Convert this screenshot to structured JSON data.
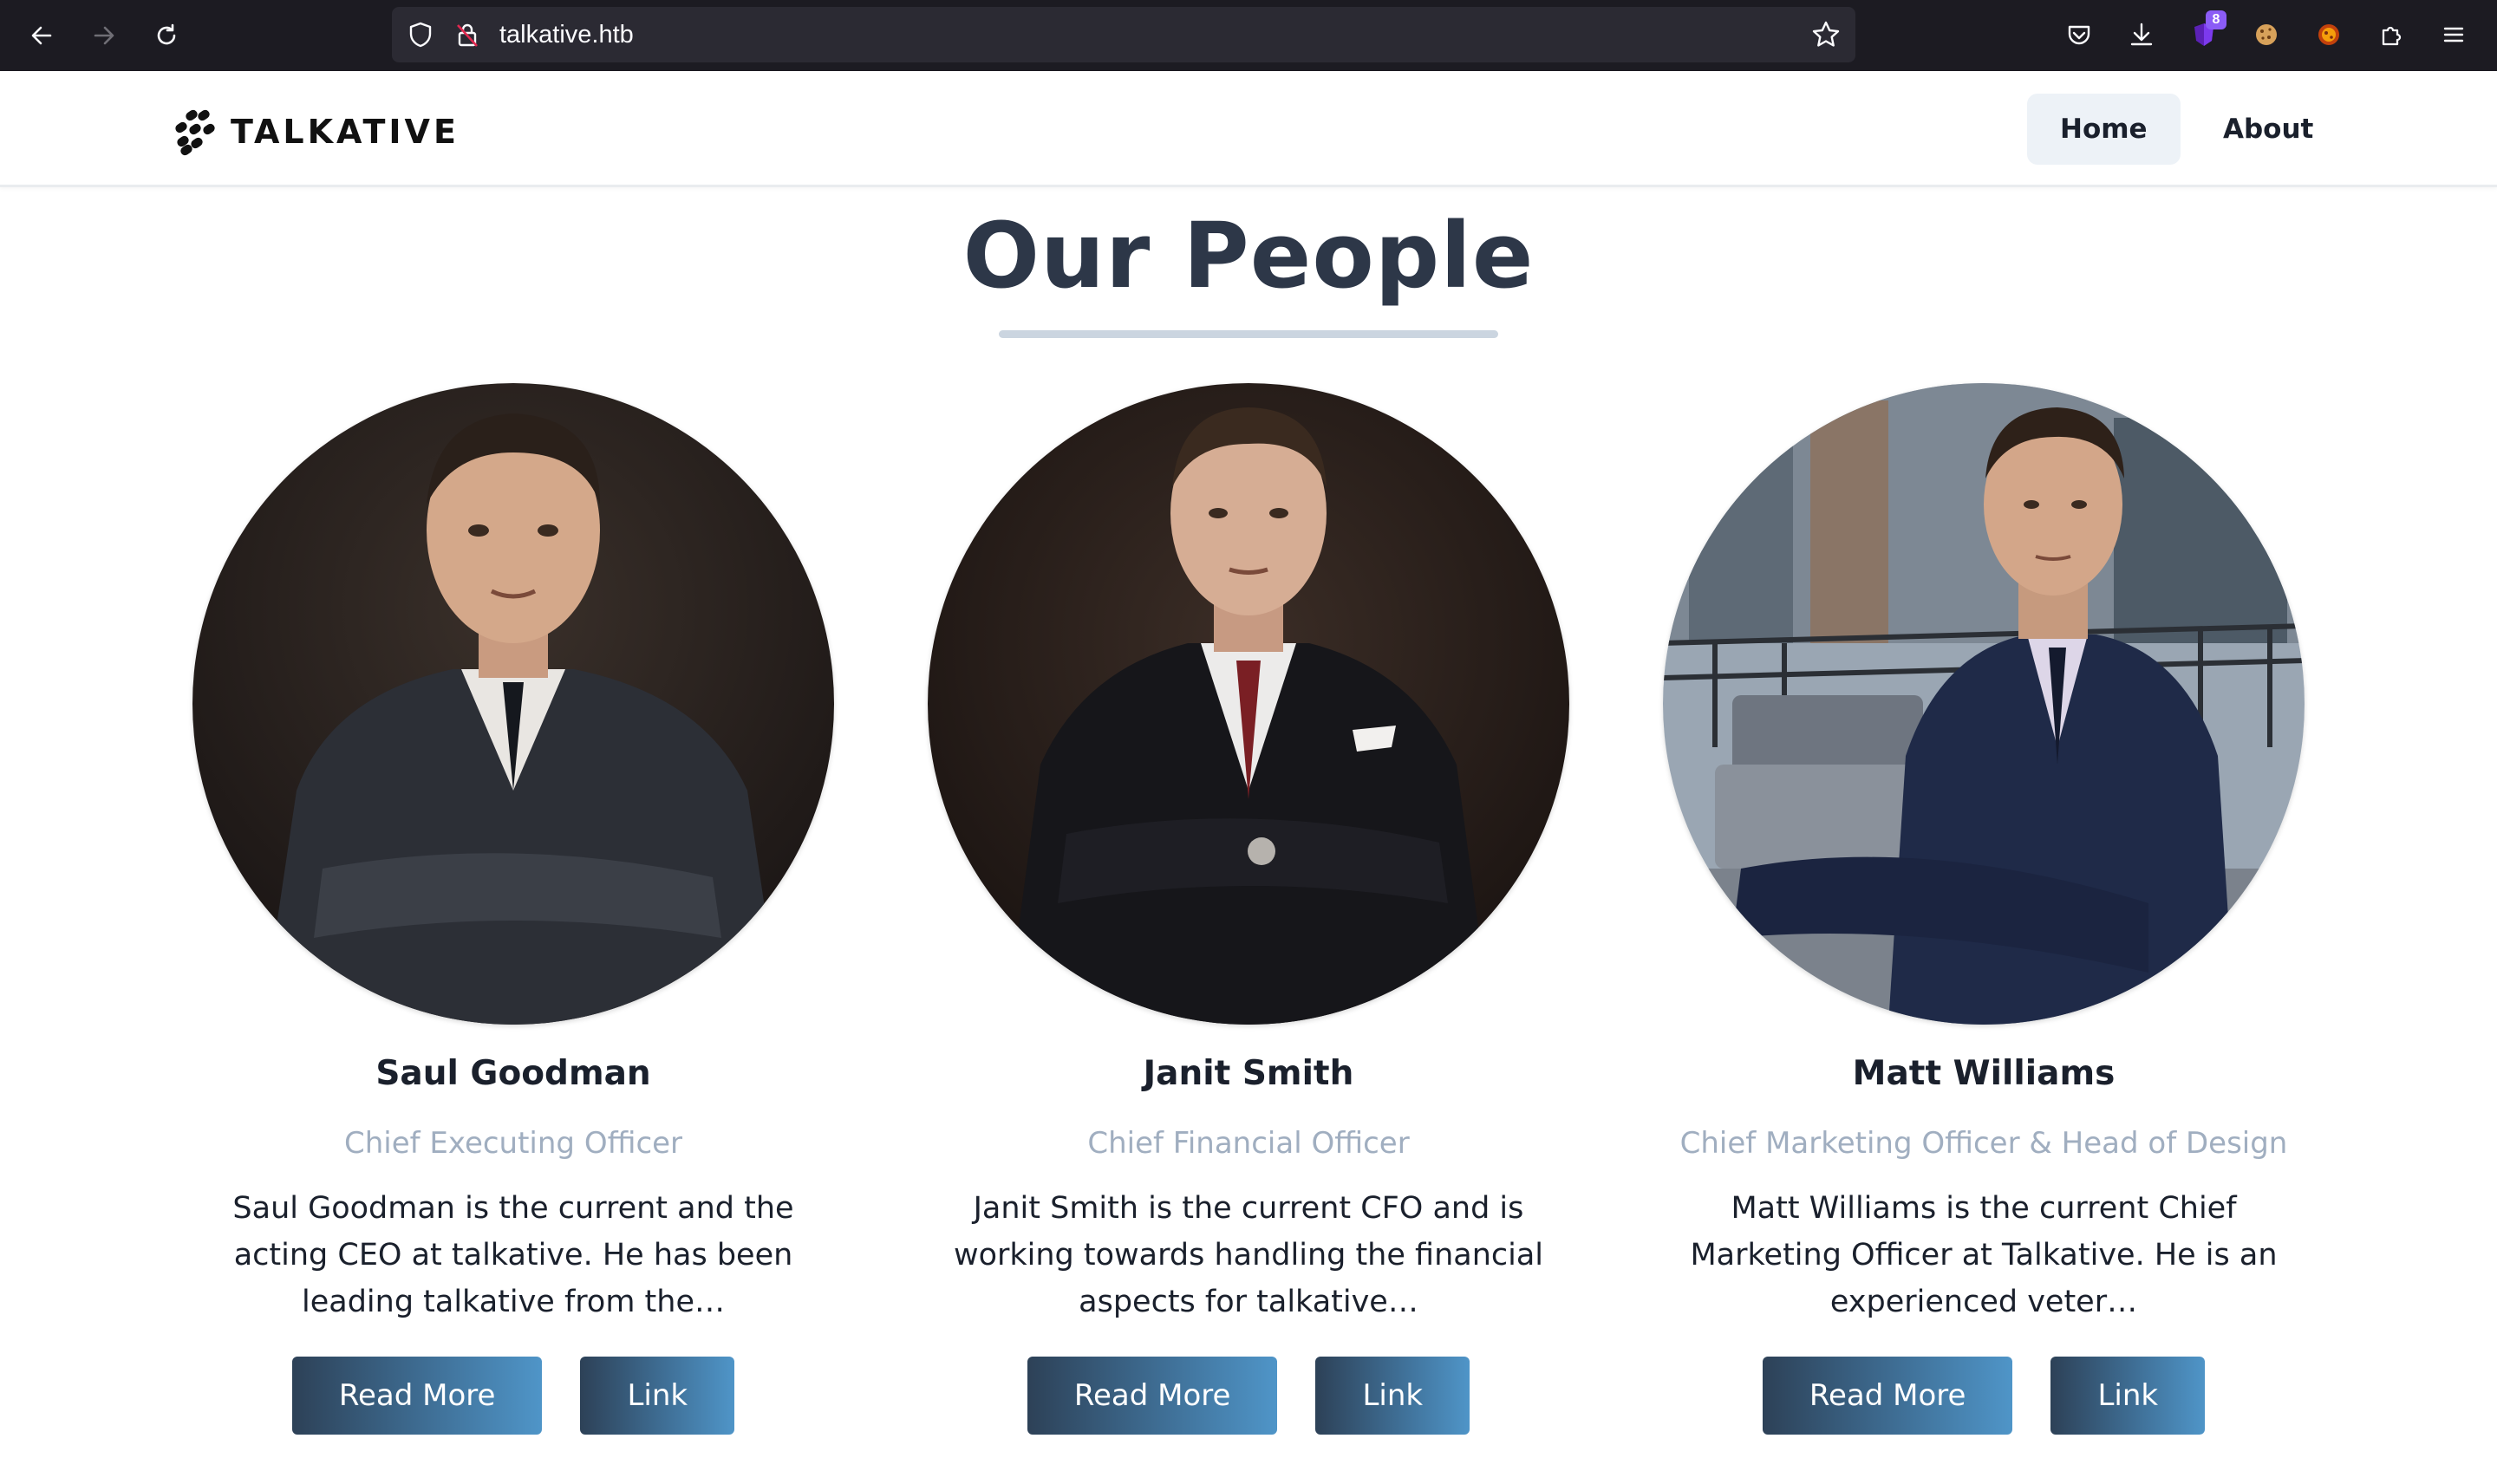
{
  "browser": {
    "url": "talkative.htb",
    "extension_badge": "8",
    "accent": "#1c1b22"
  },
  "site": {
    "logo_text": "TALKATIVE",
    "nav": [
      {
        "label": "Home",
        "active": true
      },
      {
        "label": "About",
        "active": false
      }
    ]
  },
  "section": {
    "title": "Our People"
  },
  "people": [
    {
      "name": "Saul Goodman",
      "role": "Chief Executing Officer",
      "bio": "Saul Goodman is the current and the acting CEO at talkative. He has been leading talkative from the…",
      "read_more": "Read More",
      "link": "Link"
    },
    {
      "name": "Janit Smith",
      "role": "Chief Financial Officer",
      "bio": "Janit Smith is the current CFO and is working towards handling the financial aspects for talkative…",
      "read_more": "Read More",
      "link": "Link"
    },
    {
      "name": "Matt Williams",
      "role": "Chief Marketing Officer & Head of Design",
      "bio": "Matt Williams is the current Chief Marketing Officer  at Talkative. He is an experienced veter…",
      "read_more": "Read More",
      "link": "Link"
    }
  ],
  "colors": {
    "title": "#2d3748",
    "role": "#a0aec0",
    "button_start": "#2d4157",
    "button_end": "#4f95c8"
  }
}
